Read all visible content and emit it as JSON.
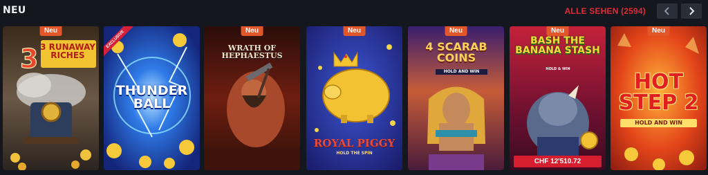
{
  "header": {
    "title": "NEU",
    "see_all": "ALLE SEHEN (2594)"
  },
  "games": [
    {
      "badge": "Neu",
      "title": "3 RUNAWAY RICHES"
    },
    {
      "ribbon": "EXCLUSIVE",
      "title": "THUNDER BALL"
    },
    {
      "badge": "Neu",
      "title": "WRATH OF HEPHAESTUS"
    },
    {
      "badge": "Neu",
      "title": "ROYAL PIGGY",
      "subtitle": "HOLD THE SPIN"
    },
    {
      "badge": "Neu",
      "title": "4 SCARAB COINS",
      "subtitle": "HOLD AND WIN"
    },
    {
      "badge": "Neu",
      "title": "BASH THE BANANA STASH",
      "subtitle": "HOLD & WIN",
      "jackpot": "CHF 12'510.72"
    },
    {
      "badge": "Neu",
      "title": "HOT STEP 2",
      "subtitle": "HOLD AND WIN"
    }
  ],
  "colors": {
    "background": "#14171d",
    "accent": "#e02b38",
    "badge": "#e2572a"
  },
  "icons": {
    "prev": "chevron-left-icon",
    "next": "chevron-right-icon"
  }
}
